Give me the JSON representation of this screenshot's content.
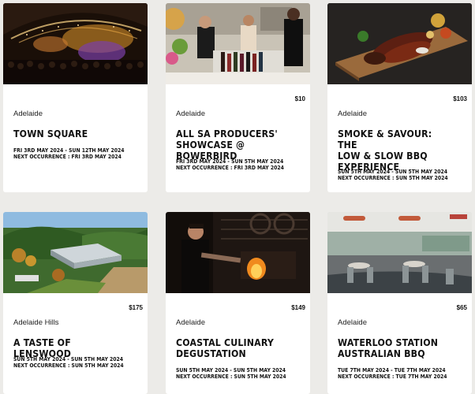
{
  "events": [
    {
      "image": "town-square-concert",
      "price": "",
      "location": "Adelaide",
      "title": "TOWN SQUARE",
      "date_range": "FRI 3RD MAY 2024 - SUN 12TH MAY 2024",
      "next_occurrence": "NEXT OCCURRENCE : FRI 3RD MAY 2024"
    },
    {
      "image": "producers-market",
      "price": "$10",
      "location": "Adelaide",
      "title": "ALL SA PRODUCERS'\nSHOWCASE @ BOWERBIRD",
      "date_range": "FRI 3RD MAY 2024 - SUN 5TH MAY 2024",
      "next_occurrence": "NEXT OCCURRENCE : FRI 3RD MAY 2024"
    },
    {
      "image": "bbq-platter",
      "price": "$103",
      "location": "Adelaide",
      "title": "SMOKE & SAVOUR: THE\nLOW & SLOW BBQ\nEXPERIENCE",
      "date_range": "SUN 5TH MAY 2024 - SUN 5TH MAY 2024",
      "next_occurrence": "NEXT OCCURRENCE : SUN 5TH MAY 2024"
    },
    {
      "image": "lenswood-aerial",
      "price": "$175",
      "location": "Adelaide Hills",
      "title": "A TASTE OF LENSWOOD",
      "date_range": "SUN 5TH MAY 2024 - SUN 5TH MAY 2024",
      "next_occurrence": "NEXT OCCURRENCE : SUN 5TH MAY 2024"
    },
    {
      "image": "chef-at-grill",
      "price": "$149",
      "location": "Adelaide",
      "title": "COASTAL CULINARY\nDEGUSTATION",
      "date_range": "SUN 5TH MAY 2024 - SUN 5TH MAY 2024",
      "next_occurrence": "NEXT OCCURRENCE : SUN 5TH MAY 2024"
    },
    {
      "image": "restaurant-interior",
      "price": "$65",
      "location": "Adelaide",
      "title": "WATERLOO STATION\nAUSTRALIAN BBQ",
      "date_range": "TUE 7TH MAY 2024 - TUE 7TH MAY 2024",
      "next_occurrence": "NEXT OCCURRENCE : TUE 7TH MAY 2024"
    }
  ]
}
